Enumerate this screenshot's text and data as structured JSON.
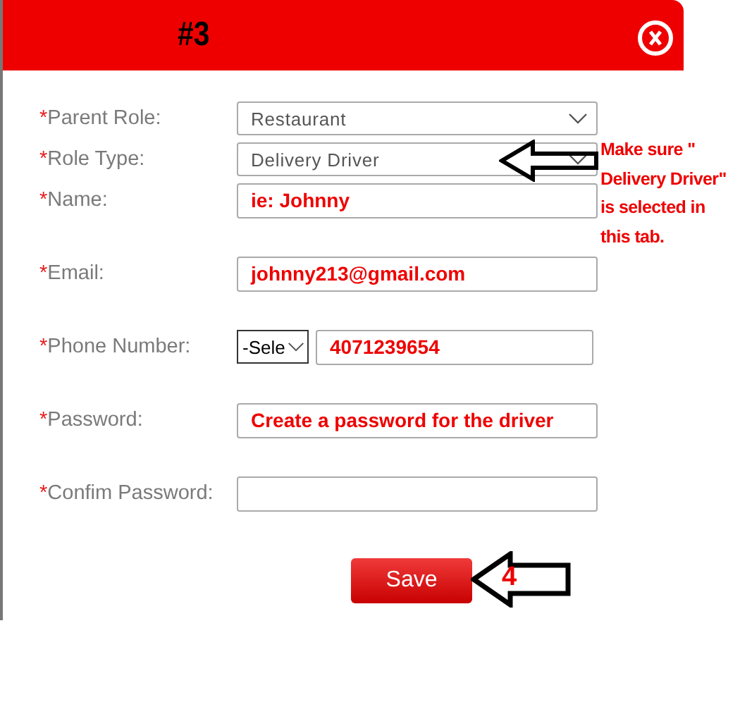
{
  "dialog": {
    "title": "#3"
  },
  "fields": [
    {
      "kind": "select",
      "required_mark": "*",
      "label": "Parent Role:",
      "value": "Restaurant"
    },
    {
      "kind": "select",
      "required_mark": "*",
      "label": "Role Type:",
      "value": "Delivery Driver"
    },
    {
      "kind": "text",
      "required_mark": "*",
      "label": "Name:",
      "value": "ie: Johnny"
    },
    {
      "kind": "text",
      "required_mark": "*",
      "label": "Email:",
      "value": "johnny213@gmail.com"
    },
    {
      "kind": "phone",
      "required_mark": "*",
      "label": "Phone Number:",
      "code": "-Sele",
      "value": "4071239654"
    },
    {
      "kind": "text",
      "required_mark": "*",
      "label": "Password:",
      "value": "Create a password for the driver"
    },
    {
      "kind": "text",
      "required_mark": "*",
      "label": "Confim Password:"
    }
  ],
  "save_button": "Save",
  "annotations": {
    "role_note": "Make sure \"\nDelivery Driver\"\nis selected in\nthis tab.",
    "save_step": "4"
  }
}
